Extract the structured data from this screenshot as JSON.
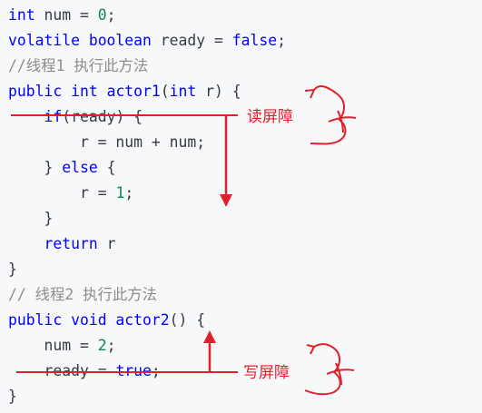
{
  "code": {
    "l1": {
      "kw": "int",
      "rest": " num = ",
      "num": "0",
      "end": ";"
    },
    "l2": {
      "kw1": "volatile",
      "kw2": " boolean",
      "rest": " ready = ",
      "kw3": "false",
      "end": ";"
    },
    "l3": {
      "comment": "//线程1 执行此方法"
    },
    "l4": {
      "kw1": "public",
      "kw2": " int",
      "fn": " actor1",
      "p1": "(",
      "kw3": "int",
      "rest": " r) {"
    },
    "l5": {
      "indent": "    ",
      "kw": "if",
      "rest": "(ready) {"
    },
    "l6": {
      "text": "        r = num + num;"
    },
    "l7": {
      "indent": "    ",
      "p1": "} ",
      "kw": "else",
      "rest": " {"
    },
    "l8": {
      "indent": "        ",
      "text": "r = ",
      "num": "1",
      "end": ";"
    },
    "l9": {
      "text": "    }"
    },
    "l10": {
      "indent": "    ",
      "kw": "return",
      "rest": " r"
    },
    "l11": {
      "text": "}"
    },
    "l12": {
      "comment": "// 线程2 执行此方法"
    },
    "l13": {
      "kw1": "public",
      "kw2": " void",
      "fn": " actor2",
      "rest": "() {"
    },
    "l14": {
      "indent": "    ",
      "text": "num = ",
      "num": "2",
      "end": ";"
    },
    "l15": {
      "indent": "    ",
      "text": "ready = ",
      "kw": "true",
      "end": ";"
    },
    "l16": {
      "text": "}"
    }
  },
  "annotations": {
    "read_barrier": "读屏障",
    "write_barrier": "写屏障"
  },
  "colors": {
    "keyword": "#0000ff",
    "number": "#098658",
    "comment": "#8c8c8c",
    "annotation": "#e0202a",
    "background": "#f6f8fa"
  }
}
